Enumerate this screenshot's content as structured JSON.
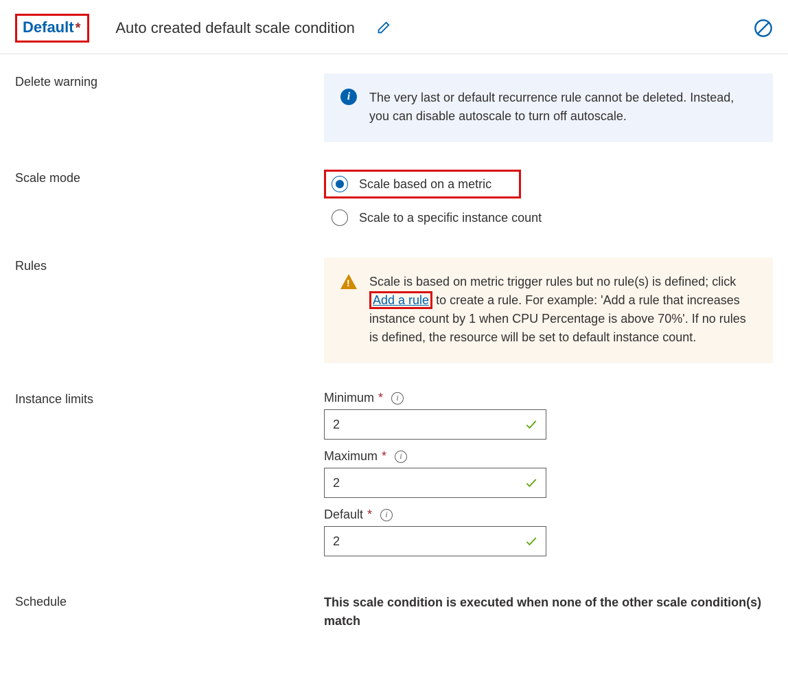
{
  "header": {
    "condition_name": "Default",
    "condition_desc": "Auto created default scale condition"
  },
  "labels": {
    "delete_warning": "Delete warning",
    "scale_mode": "Scale mode",
    "rules": "Rules",
    "instance_limits": "Instance limits",
    "schedule": "Schedule"
  },
  "delete_warning_text": "The very last or default recurrence rule cannot be deleted. Instead, you can disable autoscale to turn off autoscale.",
  "scale_mode": {
    "option_metric": "Scale based on a metric",
    "option_count": "Scale to a specific instance count",
    "selected": "metric"
  },
  "rules_warning": {
    "pre": "Scale is based on metric trigger rules but no rule(s) is defined; click ",
    "link": "Add a rule",
    "post": " to create a rule. For example: 'Add a rule that increases instance count by 1 when CPU Percentage is above 70%'. If no rules is defined, the resource will be set to default instance count."
  },
  "instance_limits": {
    "min_label": "Minimum",
    "min_value": "2",
    "max_label": "Maximum",
    "max_value": "2",
    "default_label": "Default",
    "default_value": "2"
  },
  "schedule_text": "This scale condition is executed when none of the other scale condition(s) match"
}
